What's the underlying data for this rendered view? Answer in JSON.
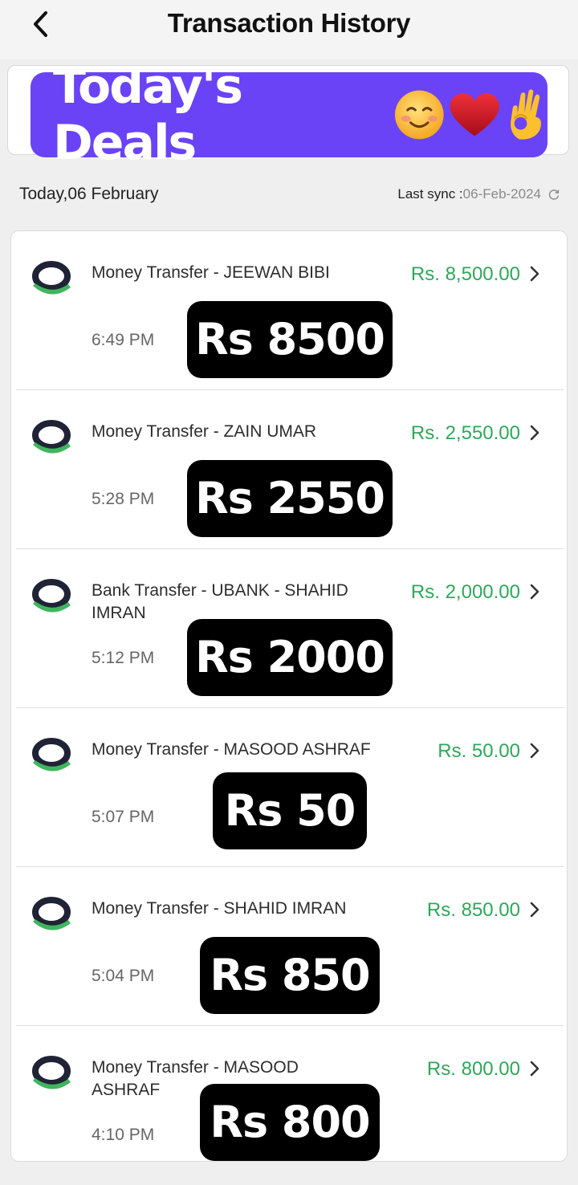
{
  "header": {
    "title": "Transaction History",
    "back_icon": "chevron-left-icon"
  },
  "banner": {
    "text": "Today's Deals",
    "emojis": [
      "smiling-face-emoji",
      "heart-emoji",
      "ok-hand-emoji"
    ],
    "color": "#6a43f6"
  },
  "datebar": {
    "date": "Today,06 February",
    "sync_label": "Last sync :",
    "sync_date": "06-Feb-2024",
    "sync_icon": "refresh-icon"
  },
  "colors": {
    "amount": "#2fa75a"
  },
  "transactions": [
    {
      "description": "Money Transfer - JEEWAN BIBI",
      "amount": "Rs. 8,500.00",
      "time": "6:49 PM",
      "overlay": "Rs 8500"
    },
    {
      "description": "Money Transfer - ZAIN UMAR",
      "amount": "Rs. 2,550.00",
      "time": "5:28 PM",
      "overlay": "Rs 2550"
    },
    {
      "description": "Bank Transfer - UBANK - SHAHID IMRAN",
      "amount": "Rs. 2,000.00",
      "time": "5:12 PM",
      "overlay": "Rs 2000"
    },
    {
      "description": "Money Transfer - MASOOD ASHRAF",
      "amount": "Rs. 50.00",
      "time": "5:07 PM",
      "overlay": "Rs 50"
    },
    {
      "description": "Money Transfer - SHAHID IMRAN",
      "amount": "Rs. 850.00",
      "time": "5:04 PM",
      "overlay": "Rs 850"
    },
    {
      "description": "Money Transfer - MASOOD ASHRAF",
      "amount": "Rs. 800.00",
      "time": "4:10 PM",
      "overlay": "Rs 800"
    }
  ]
}
